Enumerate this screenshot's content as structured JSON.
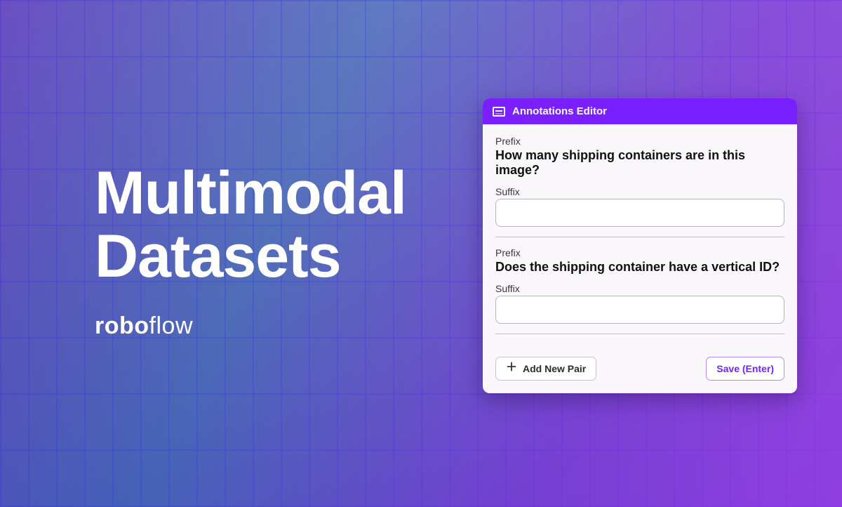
{
  "hero": {
    "line1": "Multimodal",
    "line2": "Datasets",
    "brand_bold": "robo",
    "brand_rest": "flow"
  },
  "panel": {
    "title": "Annotations Editor",
    "labels": {
      "prefix": "Prefix",
      "suffix": "Suffix"
    },
    "pairs": [
      {
        "prefix": "How many shipping containers are in this image?",
        "suffix": ""
      },
      {
        "prefix": "Does the shipping container have a vertical ID?",
        "suffix": ""
      }
    ],
    "buttons": {
      "add": "Add New Pair",
      "save": "Save (Enter)"
    }
  },
  "colors": {
    "accent": "#7a1fff"
  }
}
